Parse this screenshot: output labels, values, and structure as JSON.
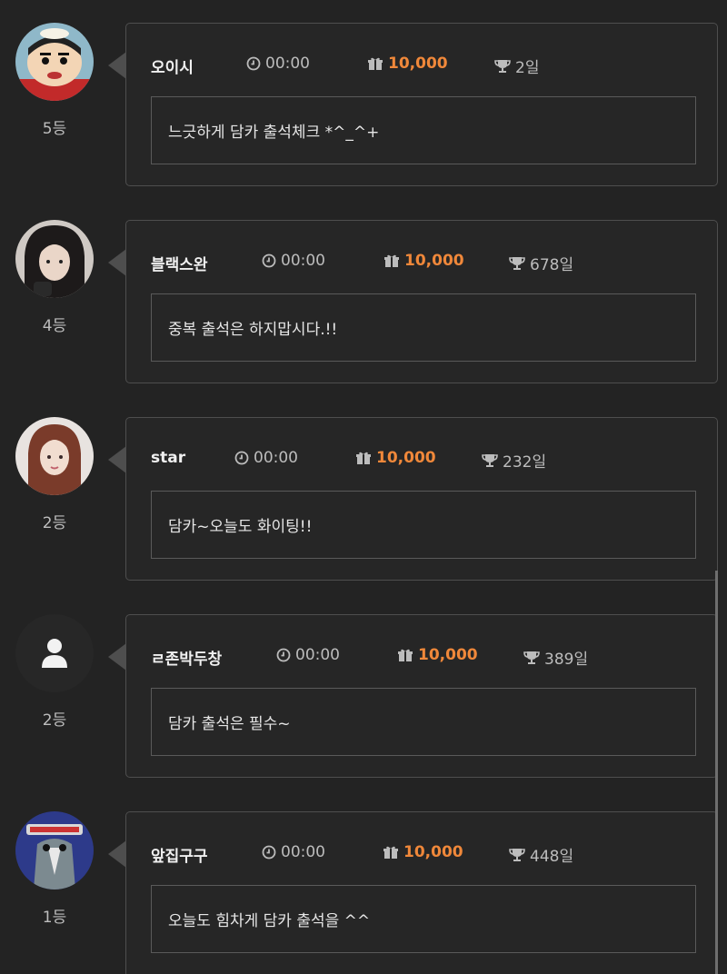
{
  "entries": [
    {
      "rank": "5등",
      "nickname": "오이시",
      "time": "00:00",
      "points": "10,000",
      "days": "2일",
      "message": "느긋하게 담카 출석체크 *^_^+",
      "avatar": "cartoon"
    },
    {
      "rank": "4등",
      "nickname": "블랙스완",
      "time": "00:00",
      "points": "10,000",
      "days": "678일",
      "message": "중복 출석은 하지맙시다.!!",
      "avatar": "woman-dark"
    },
    {
      "rank": "2등",
      "nickname": "star",
      "time": "00:00",
      "points": "10,000",
      "days": "232일",
      "message": "담카~오늘도 화이팅!!",
      "avatar": "woman-brown"
    },
    {
      "rank": "2등",
      "nickname": "ㄹ존박두창",
      "time": "00:00",
      "points": "10,000",
      "days": "389일",
      "message": "담카 출석은 필수~",
      "avatar": "default-user"
    },
    {
      "rank": "1등",
      "nickname": "앞집구구",
      "time": "00:00",
      "points": "10,000",
      "days": "448일",
      "message": "오늘도 힘차게 담카 출석을 ^^",
      "avatar": "bird"
    }
  ],
  "colors": {
    "points": "#f0883a",
    "background": "#232323",
    "border": "#4e4e4e"
  },
  "icons": {
    "time": "clock-icon",
    "points": "gift-icon",
    "days": "trophy-icon"
  }
}
